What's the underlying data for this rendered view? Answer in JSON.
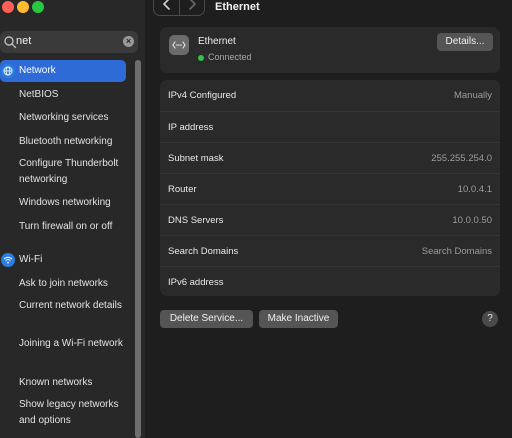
{
  "window": {
    "title": "Ethernet"
  },
  "search": {
    "value": "net",
    "clear_glyph": "×"
  },
  "sidebar": {
    "sections": [
      {
        "label": "Network",
        "icon": "globe-icon",
        "active": true,
        "items": [
          "NetBIOS",
          "Networking services",
          "Bluetooth networking",
          "Configure Thunderbolt networking",
          "Windows networking",
          "Turn firewall on or off"
        ]
      },
      {
        "label": "Wi-Fi",
        "icon": "wifi-icon",
        "active": false,
        "items": [
          "Ask to join networks",
          "Current network details",
          "Joining a Wi-Fi network",
          "Known networks",
          "Show legacy networks and options"
        ]
      }
    ]
  },
  "service": {
    "name": "Ethernet",
    "status": "Connected",
    "details_label": "Details...",
    "icon": "ethernet-icon"
  },
  "rows": [
    {
      "key": "IPv4 Configured",
      "value": "Manually"
    },
    {
      "key": "IP address",
      "value": ""
    },
    {
      "key": "Subnet mask",
      "value": "255.255.254.0"
    },
    {
      "key": "Router",
      "value": "10.0.4.1"
    },
    {
      "key": "DNS Servers",
      "value": "10.0.0.50"
    },
    {
      "key": "Search Domains",
      "value": "Search Domains"
    },
    {
      "key": "IPv6 address",
      "value": ""
    }
  ],
  "actions": {
    "delete_label": "Delete Service...",
    "inactive_label": "Make Inactive",
    "help_label": "?"
  },
  "colors": {
    "accent": "#2f6bd6",
    "status_green": "#31c24e"
  }
}
